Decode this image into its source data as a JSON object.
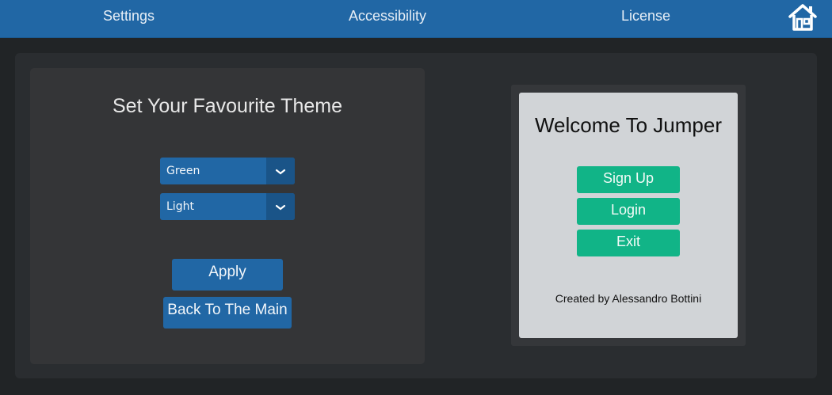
{
  "nav": {
    "settings": "Settings",
    "accessibility": "Accessibility",
    "license": "License",
    "home_icon": "home-icon"
  },
  "theme": {
    "title": "Set Your Favourite Theme",
    "color_select": {
      "value": "Green"
    },
    "mode_select": {
      "value": "Light"
    },
    "apply_label": "Apply",
    "back_label": "Back To The Main"
  },
  "preview": {
    "title": "Welcome To Jumper",
    "signup_label": "Sign Up",
    "login_label": "Login",
    "exit_label": "Exit",
    "credit": "Created by Alessandro Bottini"
  },
  "colors": {
    "nav_blue": "#2167a5",
    "accent_green": "#11b487",
    "background": "#212426"
  }
}
